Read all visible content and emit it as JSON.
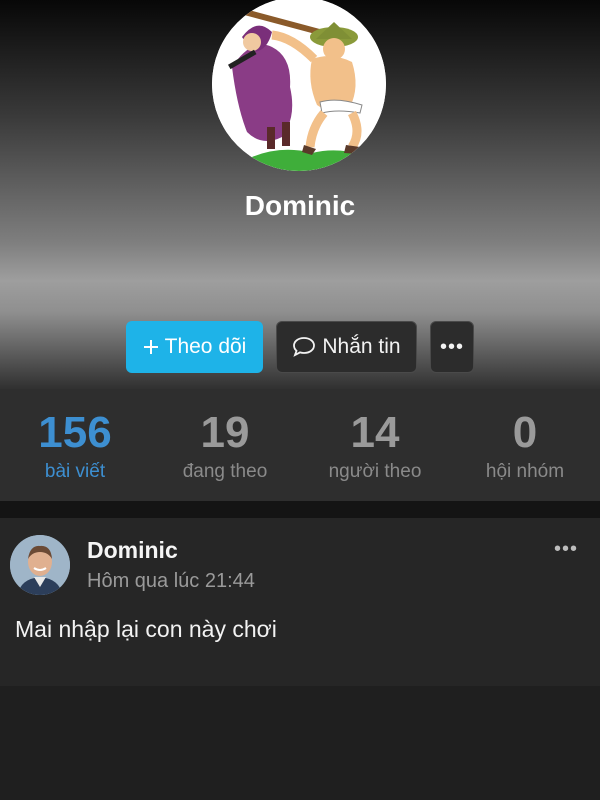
{
  "profile": {
    "name": "Dominic"
  },
  "actions": {
    "follow_label": "Theo dõi",
    "follow_icon": "plus-icon",
    "message_label": "Nhắn tin",
    "message_icon": "chat-bubble-icon",
    "more_label": "•••"
  },
  "stats": [
    {
      "value": "156",
      "label": "bài viết",
      "active": true
    },
    {
      "value": "19",
      "label": "đang theo",
      "active": false
    },
    {
      "value": "14",
      "label": "người theo",
      "active": false
    },
    {
      "value": "0",
      "label": "hội nhóm",
      "active": false
    }
  ],
  "post": {
    "author": "Dominic",
    "time": "Hôm qua lúc 21:44",
    "more_label": "•••",
    "text": "Mai nhập lại con này chơi"
  },
  "colors": {
    "accent": "#1eb3e8",
    "active_stat": "#3d8fd1"
  }
}
